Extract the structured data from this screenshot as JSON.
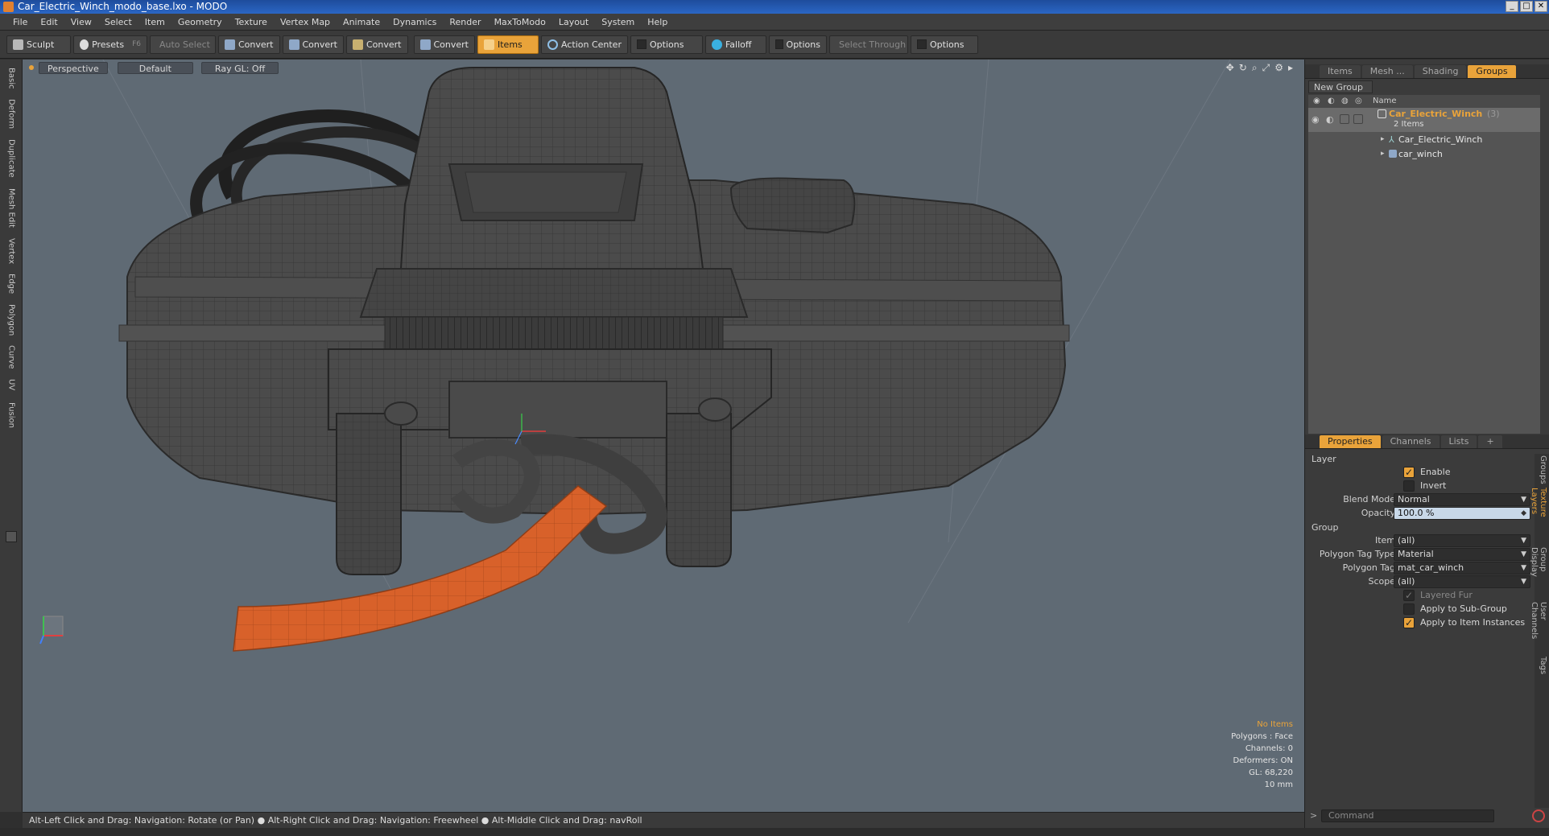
{
  "window": {
    "title": "Car_Electric_Winch_modo_base.lxo - MODO"
  },
  "menu": [
    "File",
    "Edit",
    "View",
    "Select",
    "Item",
    "Geometry",
    "Texture",
    "Vertex Map",
    "Animate",
    "Dynamics",
    "Render",
    "MaxToModo",
    "Layout",
    "System",
    "Help"
  ],
  "toolbar": {
    "sculpt": "Sculpt",
    "presets": "Presets",
    "presets_key": "F6",
    "auto_select": "Auto Select",
    "convert": "Convert",
    "items": "Items",
    "action_center": "Action Center",
    "options": "Options",
    "falloff": "Falloff",
    "select_through": "Select Through"
  },
  "left_tabs": [
    "Basic",
    "Deform",
    "Duplicate",
    "Mesh Edit",
    "Vertex",
    "Edge",
    "Polygon",
    "Curve",
    "UV",
    "Fusion"
  ],
  "viewport": {
    "view": "Perspective",
    "shading": "Default",
    "raygl": "Ray GL: Off",
    "stats": {
      "selection": "No Items",
      "polygons": "Polygons : Face",
      "channels": "Channels: 0",
      "deformers": "Deformers: ON",
      "gl": "GL: 68,220",
      "scale": "10 mm"
    }
  },
  "status": "Alt-Left Click and Drag: Navigation: Rotate (or Pan) ● Alt-Right Click and Drag: Navigation: Freewheel ● Alt-Middle Click and Drag: navRoll",
  "groups_panel": {
    "tabs": [
      "Items",
      "Mesh ...",
      "Shading",
      "Groups"
    ],
    "active_tab": "Groups",
    "new_group": "New Group",
    "name_header": "Name",
    "group_name": "Car_Electric_Winch",
    "group_count": "(3)",
    "group_sub": "2 Items",
    "children": [
      "Car_Electric_Winch",
      "car_winch"
    ]
  },
  "properties_panel": {
    "tabs": [
      "Properties",
      "Channels",
      "Lists",
      "+"
    ],
    "layer_section": "Layer",
    "enable": "Enable",
    "invert": "Invert",
    "blend_mode_label": "Blend Mode",
    "blend_mode": "Normal",
    "opacity_label": "Opacity",
    "opacity": "100.0 %",
    "group_section": "Group",
    "item_label": "Item",
    "item": "(all)",
    "poly_tag_type_label": "Polygon Tag Type",
    "poly_tag_type": "Material",
    "poly_tag_label": "Polygon Tag",
    "poly_tag": "mat_car_winch",
    "scope_label": "Scope",
    "scope": "(all)",
    "layered_fur": "Layered Fur",
    "apply_subgroup": "Apply to Sub-Group",
    "apply_instances": "Apply to Item Instances",
    "side_tabs": [
      "Groups",
      "Texture Layers",
      "Group Display",
      "User Channels",
      "Tags"
    ]
  },
  "command": {
    "placeholder": "Command"
  },
  "colors": {
    "accent": "#e9a33a",
    "strap": "#d8612a",
    "viewport_bg": "#5f6a74",
    "mesh": "#4a4a4a"
  }
}
